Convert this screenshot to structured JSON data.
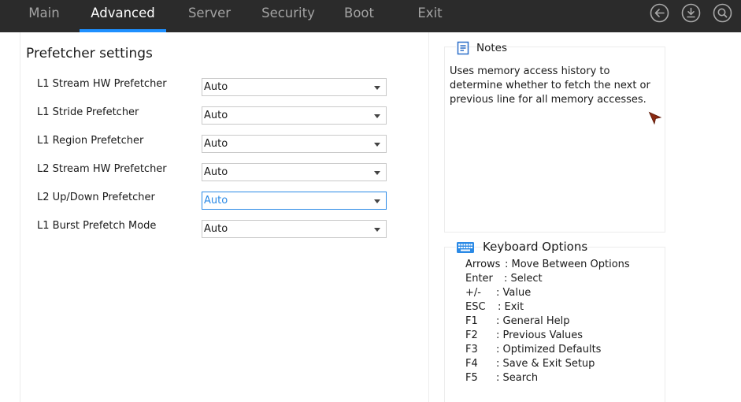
{
  "tabs": [
    {
      "label": "Main",
      "active": false
    },
    {
      "label": "Advanced",
      "active": true
    },
    {
      "label": "Server",
      "active": false
    },
    {
      "label": "Security",
      "active": false
    },
    {
      "label": "Boot",
      "active": false
    },
    {
      "label": "Exit",
      "active": false
    }
  ],
  "top_icons": [
    "back-icon",
    "save-download-icon",
    "search-icon"
  ],
  "accent_color": "#1e90ff",
  "section_title": "Prefetcher settings",
  "settings": [
    {
      "label": "L1 Stream HW Prefetcher",
      "value": "Auto",
      "focused": false
    },
    {
      "label": "L1 Stride Prefetcher",
      "value": "Auto",
      "focused": false
    },
    {
      "label": "L1 Region Prefetcher",
      "value": "Auto",
      "focused": false
    },
    {
      "label": "L2 Stream HW Prefetcher",
      "value": "Auto",
      "focused": false
    },
    {
      "label": "L2 Up/Down Prefetcher",
      "value": "Auto",
      "focused": true
    },
    {
      "label": "L1 Burst Prefetch Mode",
      "value": "Auto",
      "focused": false
    }
  ],
  "notes": {
    "title": "Notes",
    "text": "Uses memory access history to determine whether to fetch the next or previous line for all memory accesses."
  },
  "keyboard": {
    "title": "Keyboard Options",
    "items": [
      {
        "key": "Arrows",
        "desc": ": Move Between Options"
      },
      {
        "key": "Enter",
        "desc": ": Select"
      },
      {
        "key": "+/-",
        "desc": ": Value"
      },
      {
        "key": "ESC",
        "desc": ": Exit"
      },
      {
        "key": "F1",
        "desc": ": General Help"
      },
      {
        "key": "F2",
        "desc": ": Previous Values"
      },
      {
        "key": "F3",
        "desc": ": Optimized Defaults"
      },
      {
        "key": "F4",
        "desc": ": Save & Exit Setup"
      },
      {
        "key": "F5",
        "desc": ": Search"
      }
    ]
  }
}
